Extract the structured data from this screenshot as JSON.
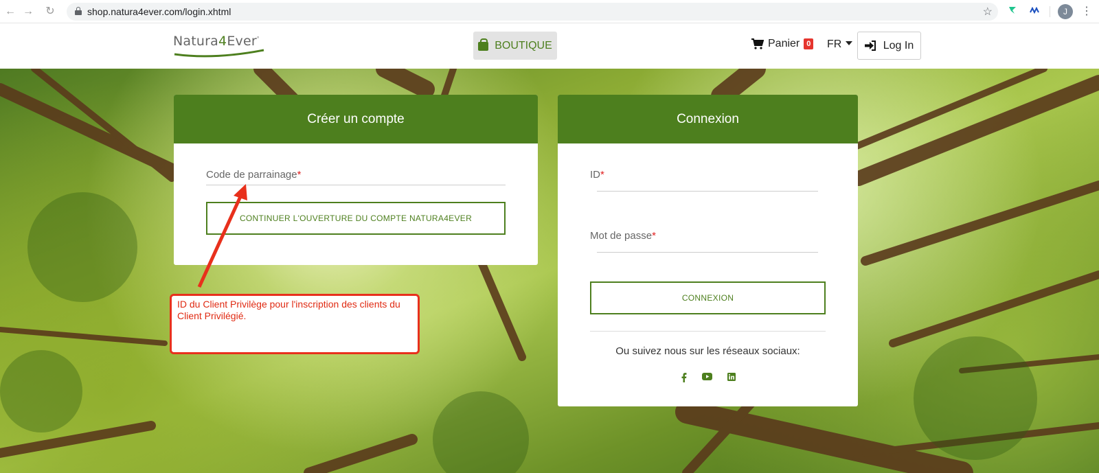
{
  "browser": {
    "url": "shop.natura4ever.com/login.xhtml",
    "avatar_initial": "J",
    "back_icon": "←",
    "forward_icon": "→",
    "reload_icon": "↻",
    "star_icon": "☆",
    "menu_icon": "⋮"
  },
  "header": {
    "logo_part1": "Natura",
    "logo_part2": "4",
    "logo_part3": "Ever",
    "shop_label": "BOUTIQUE",
    "cart_label": "Panier",
    "cart_count": "0",
    "lang": "FR",
    "login_label": "Log In"
  },
  "create_account": {
    "title": "Créer un compte",
    "referral_label": "Code de parrainage",
    "required_mark": "*",
    "continue_label": "CONTINUER L'OUVERTURE DU COMPTE NATURA4EVER"
  },
  "login": {
    "title": "Connexion",
    "id_label": "ID",
    "password_label": "Mot de passe",
    "required_mark": "*",
    "submit_label": "CONNEXION",
    "social_text": "Ou suivez nous sur les réseaux sociaux:",
    "social": [
      "facebook",
      "youtube",
      "linkedin"
    ]
  },
  "annotation": {
    "text": "ID du Client Privilège pour l'inscription des clients du Client Privilégié."
  },
  "colors": {
    "brand_green": "#4d7f1e",
    "annotation_red": "#e8301c",
    "badge_red": "#e5352e"
  }
}
